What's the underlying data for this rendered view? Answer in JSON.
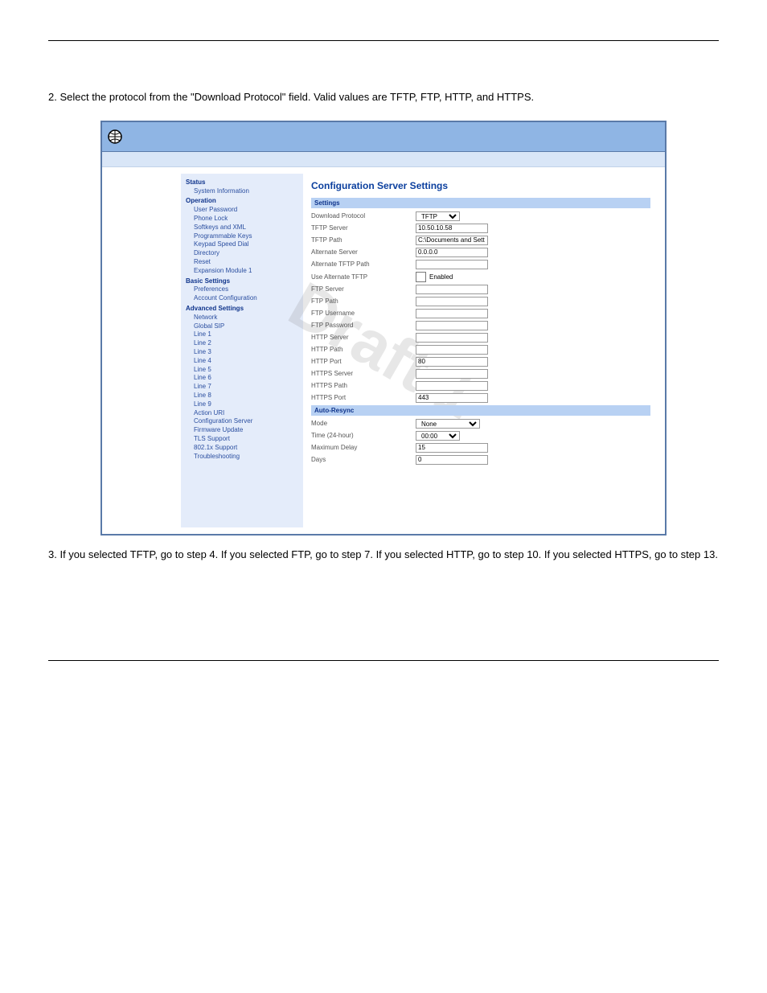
{
  "page_intro": "2. Select the protocol from the \"Download Protocol\" field. Valid values are TFTP, FTP, HTTP, and HTTPS.",
  "watermark": "Draft 1",
  "sidebar": {
    "status": {
      "heading": "Status",
      "items": [
        "System Information"
      ]
    },
    "operation": {
      "heading": "Operation",
      "items": [
        "User Password",
        "Phone Lock",
        "Softkeys and XML",
        "Programmable Keys",
        "Keypad Speed Dial",
        "Directory",
        "Reset",
        "Expansion Module 1"
      ]
    },
    "basic": {
      "heading": "Basic Settings",
      "items": [
        "Preferences",
        "Account Configuration"
      ]
    },
    "advanced": {
      "heading": "Advanced Settings",
      "items": [
        "Network",
        "Global SIP",
        "Line 1",
        "Line 2",
        "Line 3",
        "Line 4",
        "Line 5",
        "Line 6",
        "Line 7",
        "Line 8",
        "Line 9",
        "Action URI",
        "Configuration Server",
        "Firmware Update",
        "TLS Support",
        "802.1x Support",
        "Troubleshooting"
      ]
    }
  },
  "panel": {
    "title": "Configuration Server Settings",
    "section_settings": "Settings",
    "section_resync": "Auto-Resync",
    "rows": {
      "download_protocol": {
        "label": "Download Protocol",
        "value": "TFTP"
      },
      "tftp_server": {
        "label": "TFTP Server",
        "value": "10.50.10.58"
      },
      "tftp_path": {
        "label": "TFTP Path",
        "value": "C:\\Documents and Sett"
      },
      "alternate_server": {
        "label": "Alternate Server",
        "value": "0.0.0.0"
      },
      "alternate_tftp_path": {
        "label": "Alternate TFTP Path",
        "value": ""
      },
      "use_alternate_tftp": {
        "label": "Use Alternate TFTP",
        "checkbox_label": "Enabled"
      },
      "ftp_server": {
        "label": "FTP Server",
        "value": ""
      },
      "ftp_path": {
        "label": "FTP Path",
        "value": ""
      },
      "ftp_username": {
        "label": "FTP Username",
        "value": ""
      },
      "ftp_password": {
        "label": "FTP Password",
        "value": ""
      },
      "http_server": {
        "label": "HTTP Server",
        "value": ""
      },
      "http_path": {
        "label": "HTTP Path",
        "value": ""
      },
      "http_port": {
        "label": "HTTP Port",
        "value": "80"
      },
      "https_server": {
        "label": "HTTPS Server",
        "value": ""
      },
      "https_path": {
        "label": "HTTPS Path",
        "value": ""
      },
      "https_port": {
        "label": "HTTPS Port",
        "value": "443"
      },
      "mode": {
        "label": "Mode",
        "value": "None"
      },
      "time": {
        "label": "Time (24-hour)",
        "value": "00:00"
      },
      "max_delay": {
        "label": "Maximum Delay",
        "value": "15"
      },
      "days": {
        "label": "Days",
        "value": "0"
      }
    }
  },
  "page_outro": "3. If you selected TFTP, go to step 4. If you selected FTP, go to step 7. If you selected HTTP, go to step 10. If you selected HTTPS, go to step 13."
}
